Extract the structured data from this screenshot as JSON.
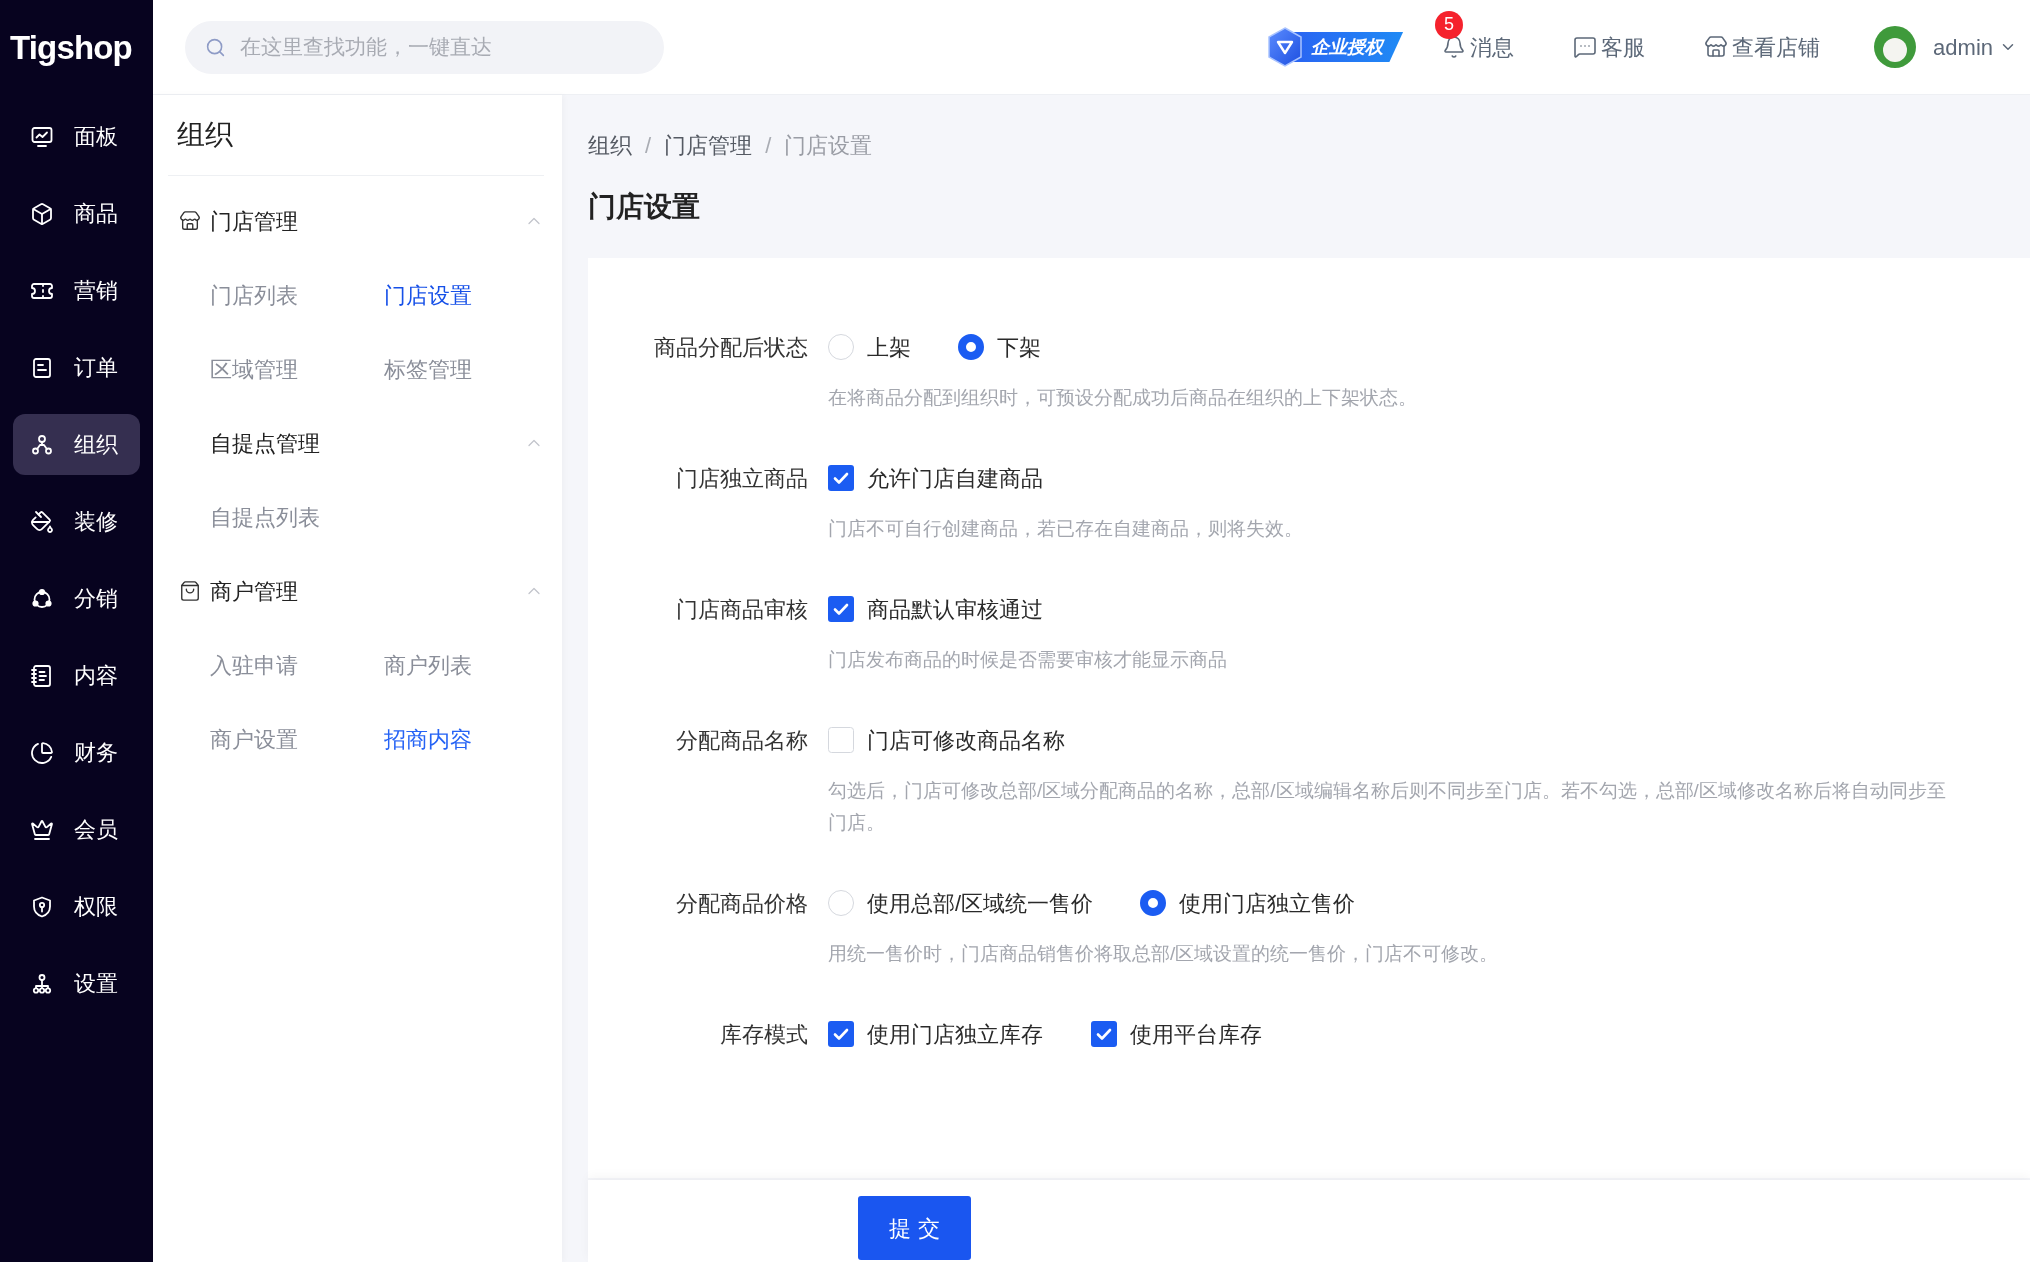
{
  "sidebar": {
    "logo": "Tigshop",
    "items": [
      {
        "label": "面板",
        "selected": false
      },
      {
        "label": "商品",
        "selected": false
      },
      {
        "label": "营销",
        "selected": false
      },
      {
        "label": "订单",
        "selected": false
      },
      {
        "label": "组织",
        "selected": true
      },
      {
        "label": "装修",
        "selected": false
      },
      {
        "label": "分销",
        "selected": false
      },
      {
        "label": "内容",
        "selected": false
      },
      {
        "label": "财务",
        "selected": false
      },
      {
        "label": "会员",
        "selected": false
      },
      {
        "label": "权限",
        "selected": false
      },
      {
        "label": "设置",
        "selected": false
      }
    ]
  },
  "topbar": {
    "search": {
      "placeholder": "在这里查找功能，一键直达"
    },
    "license_badge": "企业授权",
    "actions": [
      {
        "kind": "messages",
        "label": "消息",
        "badge": "5"
      },
      {
        "kind": "support",
        "label": "客服"
      },
      {
        "kind": "store",
        "label": "查看店铺"
      }
    ],
    "user": {
      "name": "admin"
    }
  },
  "submenu": {
    "title": "组织",
    "groups": [
      {
        "label": "门店管理",
        "expanded": true,
        "children": [
          {
            "kind": "link",
            "label": "门店列表",
            "selected": false,
            "highlighted": false
          },
          {
            "kind": "link",
            "label": "门店设置",
            "selected": true,
            "highlighted": false
          },
          {
            "kind": "link",
            "label": "区域管理",
            "selected": false,
            "highlighted": false
          },
          {
            "kind": "link",
            "label": "标签管理",
            "selected": false,
            "highlighted": false
          },
          {
            "kind": "group",
            "label": "自提点管理",
            "expanded": true,
            "children": [
              {
                "kind": "link",
                "label": "自提点列表",
                "selected": false,
                "highlighted": false
              }
            ]
          }
        ]
      },
      {
        "label": "商户管理",
        "expanded": true,
        "children": [
          {
            "kind": "link",
            "label": "入驻申请",
            "selected": false,
            "highlighted": false
          },
          {
            "kind": "link",
            "label": "商户列表",
            "selected": false,
            "highlighted": false
          },
          {
            "kind": "link",
            "label": "商户设置",
            "selected": false,
            "highlighted": false
          },
          {
            "kind": "link",
            "label": "招商内容",
            "selected": false,
            "highlighted": true
          }
        ]
      }
    ]
  },
  "breadcrumb": [
    {
      "kind": "link",
      "label": "组织"
    },
    {
      "kind": "separator",
      "label": "/"
    },
    {
      "kind": "link",
      "label": "门店管理"
    },
    {
      "kind": "separator",
      "label": "/"
    },
    {
      "kind": "current",
      "label": "门店设置"
    }
  ],
  "page_title": "门店设置",
  "form": {
    "fields": [
      {
        "label": "商品分配后状态",
        "kind": "radio",
        "options": [
          {
            "label": "上架",
            "selected": false
          },
          {
            "label": "下架",
            "selected": true
          }
        ],
        "help": "在将商品分配到组织时，可预设分配成功后商品在组织的上下架状态。"
      },
      {
        "label": "门店独立商品",
        "kind": "checkbox",
        "options": [
          {
            "label": "允许门店自建商品",
            "checked": true
          }
        ],
        "help": "门店不可自行创建商品，若已存在自建商品，则将失效。"
      },
      {
        "label": "门店商品审核",
        "kind": "checkbox",
        "options": [
          {
            "label": "商品默认审核通过",
            "checked": true
          }
        ],
        "help": "门店发布商品的时候是否需要审核才能显示商品"
      },
      {
        "label": "分配商品名称",
        "kind": "checkbox",
        "options": [
          {
            "label": "门店可修改商品名称",
            "checked": false
          }
        ],
        "help": "勾选后，门店可修改总部/区域分配商品的名称，总部/区域编辑名称后则不同步至门店。若不勾选，总部/区域修改名称后将自动同步至门店。"
      },
      {
        "label": "分配商品价格",
        "kind": "radio",
        "options": [
          {
            "label": "使用总部/区域统一售价",
            "selected": false
          },
          {
            "label": "使用门店独立售价",
            "selected": true
          }
        ],
        "help": "用统一售价时，门店商品销售价将取总部/区域设置的统一售价，门店不可修改。"
      },
      {
        "label": "库存模式",
        "kind": "checkbox",
        "options": [
          {
            "label": "使用门店独立库存",
            "checked": true
          },
          {
            "label": "使用平台库存",
            "checked": true
          }
        ]
      }
    ]
  },
  "footer": {
    "submit": "提 交"
  }
}
